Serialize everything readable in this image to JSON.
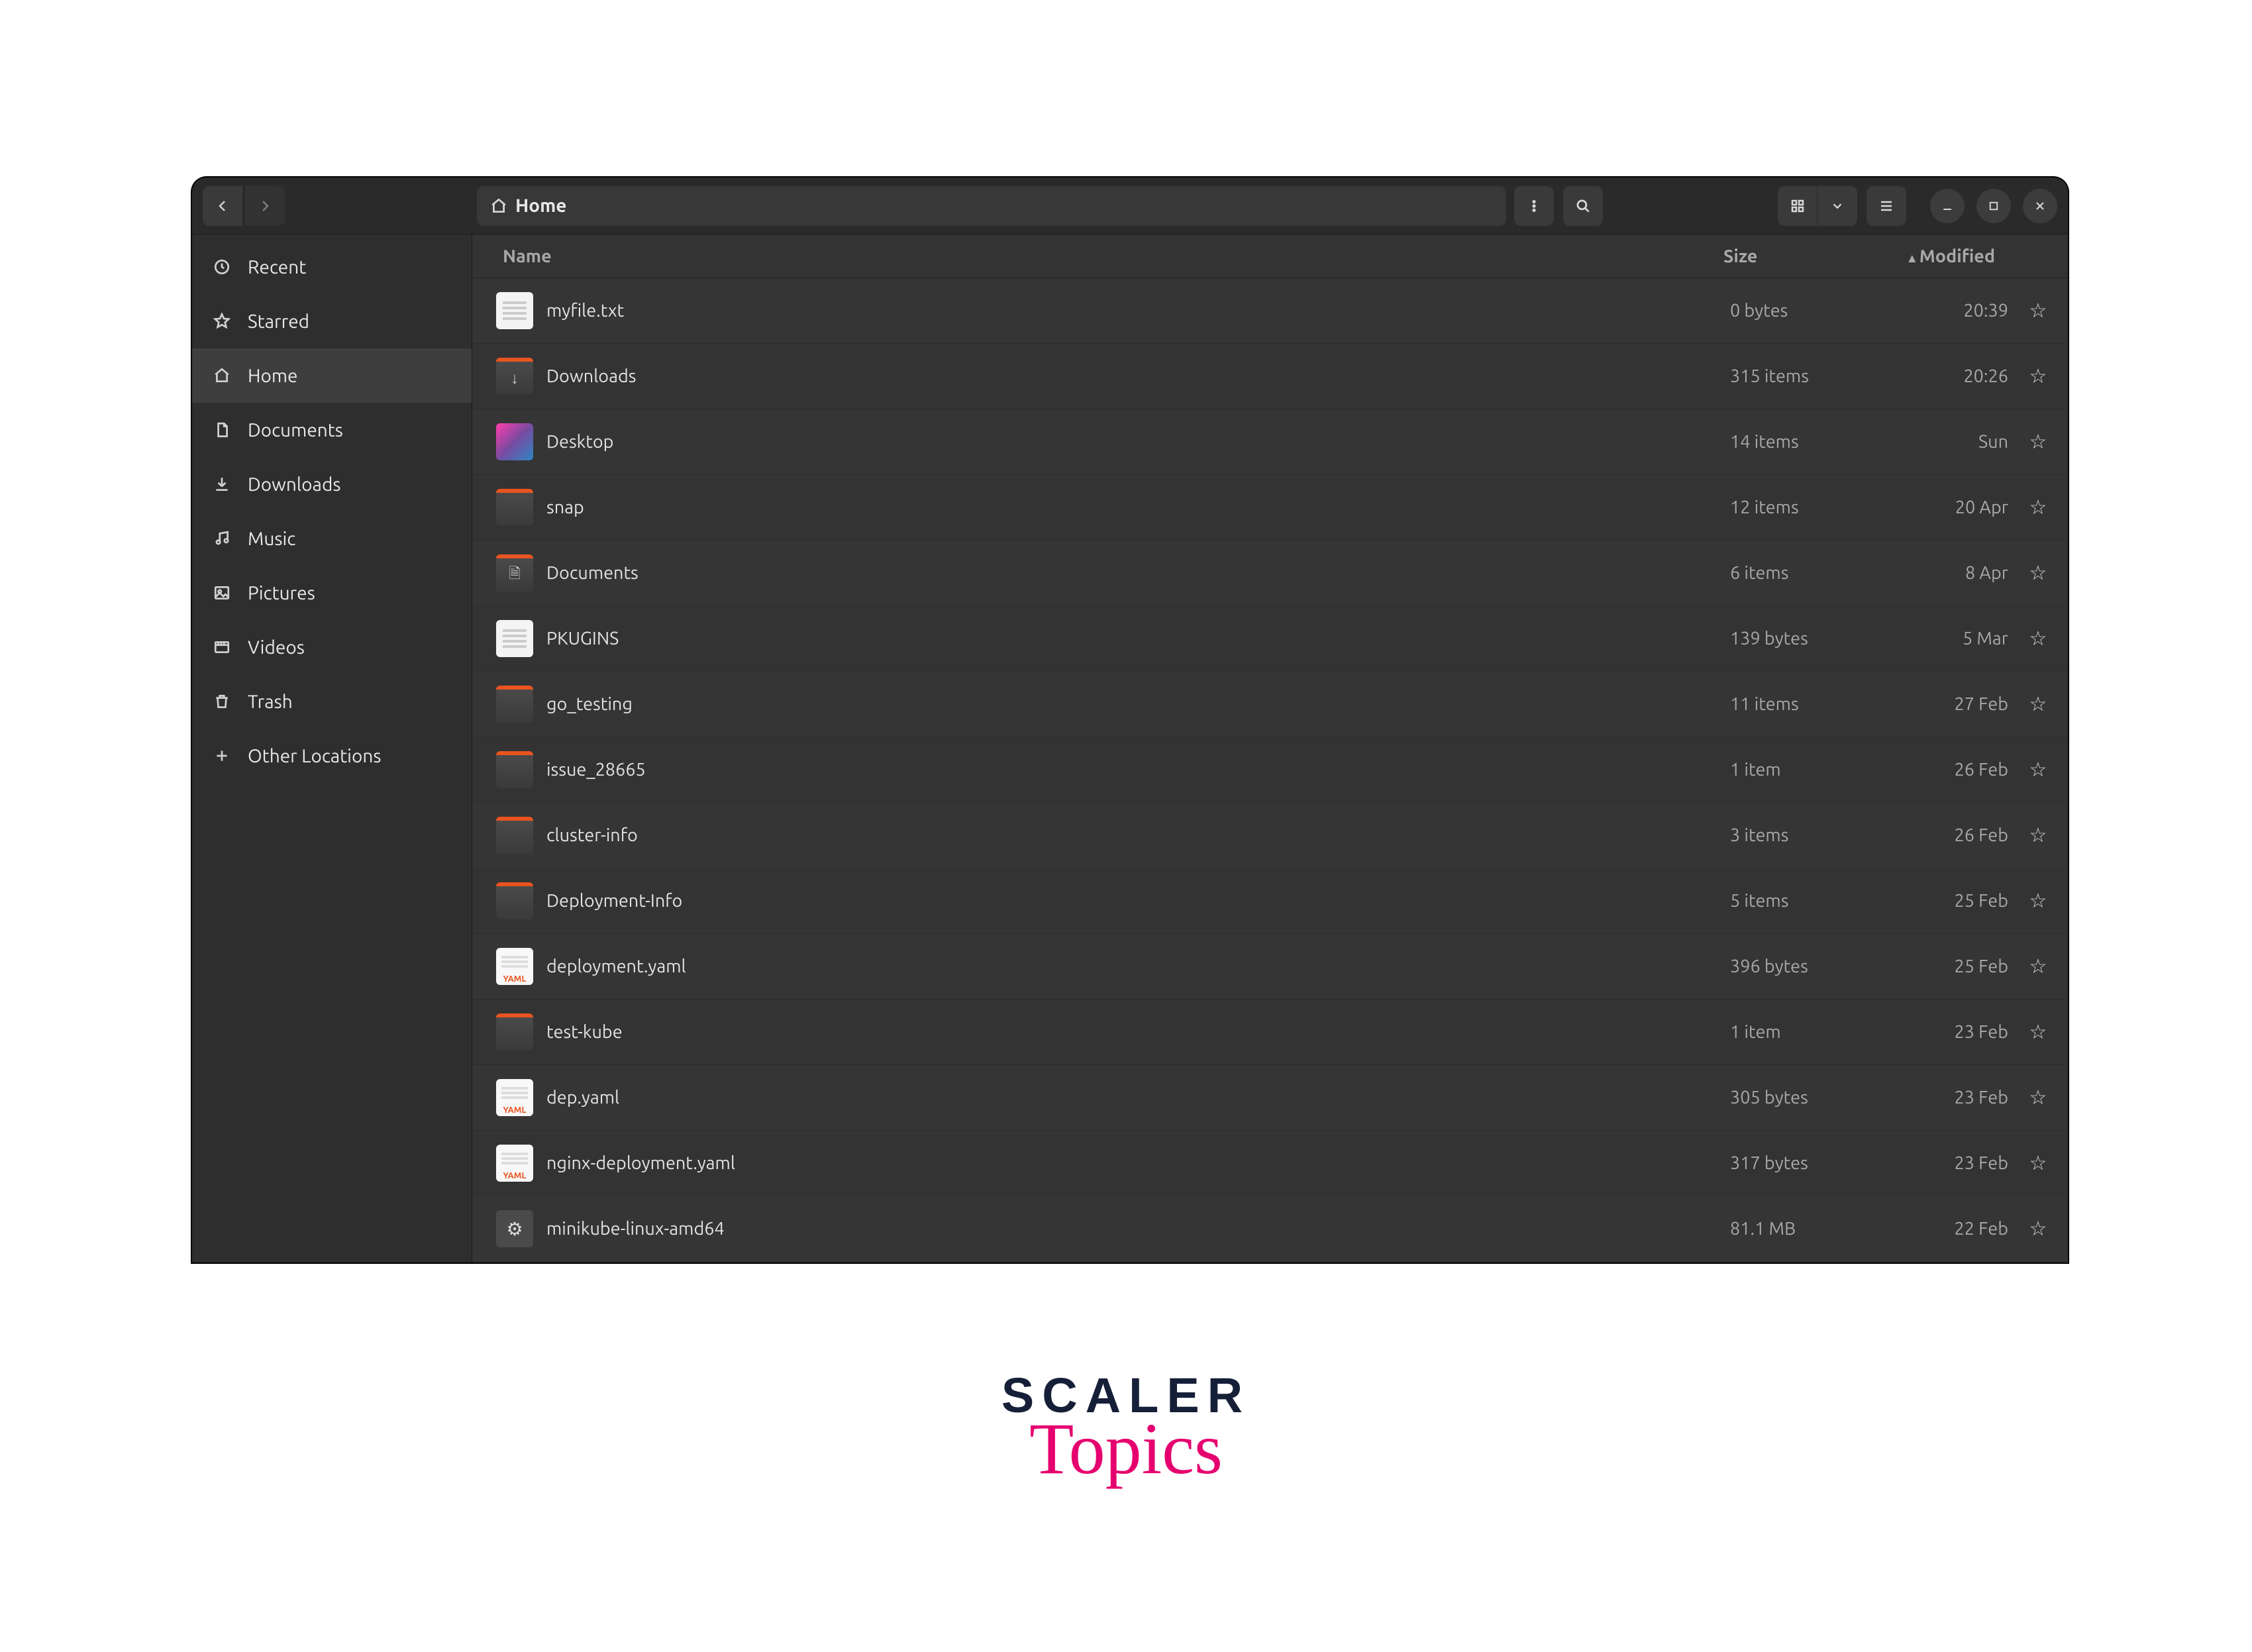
{
  "location": "Home",
  "columns": {
    "name": "Name",
    "size": "Size",
    "modified": "Modified"
  },
  "sort": {
    "column": "Modified",
    "direction": "asc"
  },
  "sidebar": [
    {
      "icon": "recent",
      "label": "Recent"
    },
    {
      "icon": "starred",
      "label": "Starred"
    },
    {
      "icon": "home",
      "label": "Home",
      "active": true
    },
    {
      "icon": "documents",
      "label": "Documents"
    },
    {
      "icon": "downloads",
      "label": "Downloads"
    },
    {
      "icon": "music",
      "label": "Music"
    },
    {
      "icon": "pictures",
      "label": "Pictures"
    },
    {
      "icon": "videos",
      "label": "Videos"
    },
    {
      "icon": "trash",
      "label": "Trash"
    },
    {
      "icon": "other",
      "label": "Other Locations"
    }
  ],
  "files": [
    {
      "icon": "text",
      "name": "myfile.txt",
      "size": "0 bytes",
      "modified": "20:39"
    },
    {
      "icon": "folder-dl",
      "name": "Downloads",
      "size": "315 items",
      "modified": "20:26"
    },
    {
      "icon": "desktop",
      "name": "Desktop",
      "size": "14 items",
      "modified": "Sun"
    },
    {
      "icon": "folder",
      "name": "snap",
      "size": "12 items",
      "modified": "20 Apr"
    },
    {
      "icon": "folder-doc",
      "name": "Documents",
      "size": "6 items",
      "modified": "8 Apr"
    },
    {
      "icon": "text",
      "name": "PKUGINS",
      "size": "139 bytes",
      "modified": "5 Mar"
    },
    {
      "icon": "folder",
      "name": "go_testing",
      "size": "11 items",
      "modified": "27 Feb"
    },
    {
      "icon": "folder",
      "name": "issue_28665",
      "size": "1 item",
      "modified": "26 Feb"
    },
    {
      "icon": "folder",
      "name": "cluster-info",
      "size": "3 items",
      "modified": "26 Feb"
    },
    {
      "icon": "folder",
      "name": "Deployment-Info",
      "size": "5 items",
      "modified": "25 Feb"
    },
    {
      "icon": "yaml",
      "name": "deployment.yaml",
      "size": "396 bytes",
      "modified": "25 Feb"
    },
    {
      "icon": "folder",
      "name": "test-kube",
      "size": "1 item",
      "modified": "23 Feb"
    },
    {
      "icon": "yaml",
      "name": "dep.yaml",
      "size": "305 bytes",
      "modified": "23 Feb"
    },
    {
      "icon": "yaml",
      "name": "nginx-deployment.yaml",
      "size": "317 bytes",
      "modified": "23 Feb"
    },
    {
      "icon": "exec",
      "name": "minikube-linux-amd64",
      "size": "81.1 MB",
      "modified": "22 Feb"
    }
  ],
  "watermark": {
    "line1": "SCALER",
    "line2": "Topics"
  }
}
